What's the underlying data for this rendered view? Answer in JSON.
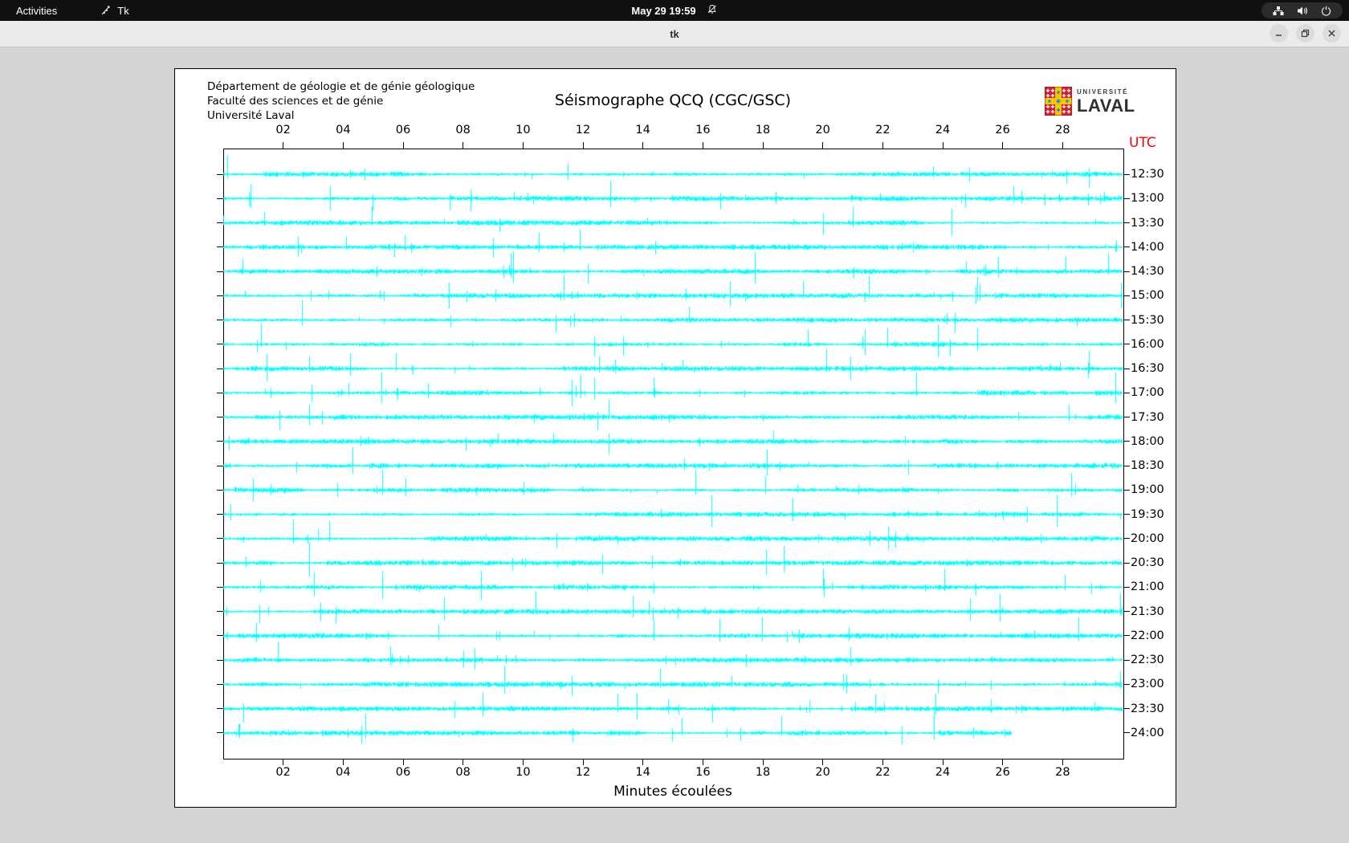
{
  "topbar": {
    "activities_label": "Activities",
    "app_indicator_label": "Tk",
    "clock": "May 29  19:59"
  },
  "titlebar": {
    "title": "tk"
  },
  "panel": {
    "institution_lines": [
      "Département de géologie et de génie géologique",
      "Faculté des sciences et de génie",
      "Université Laval"
    ],
    "logo_line1": "UNIVERSITÉ",
    "logo_line2": "LAVAL"
  },
  "chart_data": {
    "type": "line",
    "title": "Séismographe QCQ (CGC/GSC)",
    "xlabel": "Minutes écoulées",
    "right_axis_title": "UTC",
    "xlim": [
      0,
      30
    ],
    "x_tick_minutes": [
      2,
      4,
      6,
      8,
      10,
      12,
      14,
      16,
      18,
      20,
      22,
      24,
      26,
      28
    ],
    "x_tick_labels": [
      "02",
      "04",
      "06",
      "08",
      "10",
      "12",
      "14",
      "16",
      "18",
      "20",
      "22",
      "24",
      "26",
      "28"
    ],
    "grid": false,
    "trace_color": "#00ffff",
    "traces": [
      "12:30",
      "13:00",
      "13:30",
      "14:00",
      "14:30",
      "15:00",
      "15:30",
      "16:00",
      "16:30",
      "17:00",
      "17:30",
      "18:00",
      "18:30",
      "19:00",
      "19:30",
      "20:00",
      "20:30",
      "21:00",
      "21:30",
      "22:00",
      "22:30",
      "23:00",
      "23:30",
      "24:00"
    ],
    "trace_interval_minutes": 30,
    "last_trace_end_minute": 26.3,
    "waveform": "continuous background microseismic noise ~±2px with sporadic transient spikes up to ±15px on every half-hour trace"
  },
  "colors": {
    "topbar_bg": "#101010",
    "titlebar_bg": "#ebebeb",
    "window_bg": "#d4d4d4",
    "canvas_bg": "#ffffff",
    "trace": "#00ffff",
    "utc_label": "#ff0000",
    "logo_red": "#d21f2f",
    "logo_gold": "#ffc600",
    "logo_blue": "#0aa3d8"
  }
}
